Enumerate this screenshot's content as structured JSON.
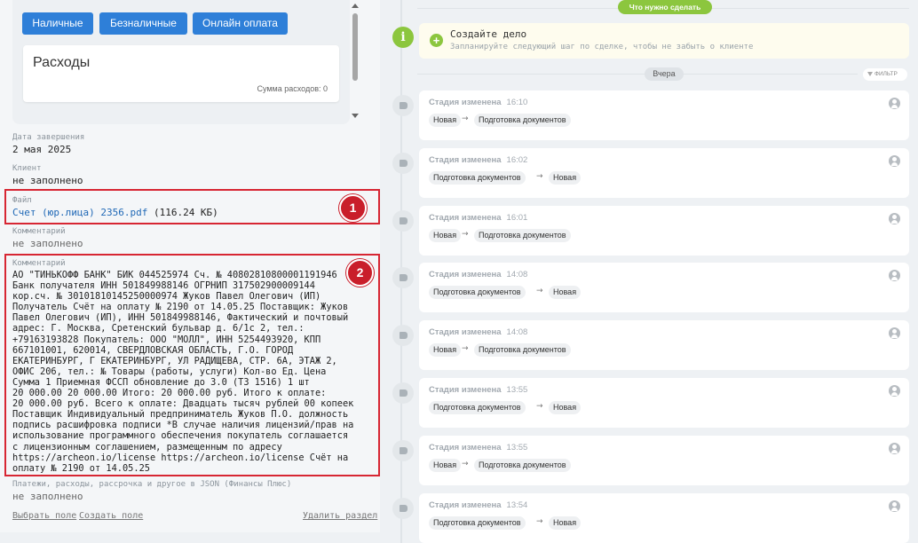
{
  "payment_buttons": [
    "Наличные",
    "Безналичные",
    "Онлайн оплата"
  ],
  "expenses": {
    "title": "Расходы",
    "sum_label": "Сумма расходов: 0"
  },
  "fields": {
    "completion_date": {
      "label": "Дата завершения",
      "value": "2 мая 2025"
    },
    "client": {
      "label": "Клиент",
      "value": "не заполнено"
    },
    "file": {
      "label": "Файл",
      "name": "Счет (юр.лица) 2356.pdf",
      "size": "(116.24 КБ)"
    },
    "comment1": {
      "label": "Комментарий",
      "value": "не заполнено"
    },
    "comment2": {
      "label": "Комментарий",
      "lines": [
        "АО \"ТИНЬКОФФ БАНК\" БИК 044525974 Сч. № 40802810800001191946",
        "Банк получателя ИНН 501849988146 ОГРНИП 317502900009144",
        "кор.сч. № 30101810145250000974 Жуков Павел Олегович (ИП)",
        "Получатель Счёт на оплату № 2190 от 14.05.25 Поставщик: Жуков",
        "Павел Олегович (ИП), ИНН 501849988146, Фактический и почтовый",
        "адрес: Г. Москва, Сретенский бульвар д. 6/1с 2, тел.:",
        "+79163193828 Покупатель: ООО \"МОЛЛ\", ИНН 5254493920, КПП",
        "667101001, 620014, СВЕРДЛОВСКАЯ ОБЛАСТЬ, Г.О. ГОРОД",
        "ЕКАТЕРИНБУРГ, Г ЕКАТЕРИНБУРГ, УЛ РАДИЩЕВА, СТР. 6А, ЭТАЖ 2,",
        "ОФИС 206, тел.: № Товары (работы, услуги) Кол-во Ед. Цена",
        "Сумма 1 Приемная ФССП обновление до 3.0 (Т3 1516) 1 шт",
        "20 000.00 20 000.00 Итого: 20 000.00 руб. Итого к оплате:",
        "20 000.00 руб. Всего к оплате: Двадцать тысяч рублей 00 копеек",
        "Поставщик Индивидуальный предприниматель Жуков П.О. должность",
        "подпись расшифровка подписи *В случае наличия лицензий/прав на",
        "использование программного обеспечения покупатель соглашается",
        "с лицензионным соглашением, размещенным по адресу",
        "https://archeon.io/license https://archeon.io/license Счёт на",
        "оплату № 2190 от 14.05.25"
      ]
    },
    "payments_json": {
      "label": "Платежи, расходы, рассрочка и другое в JSON (Финансы Плюс)",
      "value": "не заполнено"
    }
  },
  "markers": [
    "1",
    "2"
  ],
  "bottom_links": {
    "choose": "Выбрать поле",
    "create": "Создать поле",
    "delete": "Удалить раздел"
  },
  "timeline": {
    "todo_pill": "Что нужно сделать",
    "todo_title": "Создайте дело",
    "todo_subtitle": "Запланируйте следующий шаг по сделке, чтобы не забыть о клиенте",
    "day_label": "Вчера",
    "filter_label": "ФИЛЬТР",
    "events": [
      {
        "title": "Стадия изменена",
        "time": "16:10",
        "from": "Новая",
        "to": "Подготовка документов"
      },
      {
        "title": "Стадия изменена",
        "time": "16:02",
        "from": "Подготовка документов",
        "to": "Новая"
      },
      {
        "title": "Стадия изменена",
        "time": "16:01",
        "from": "Новая",
        "to": "Подготовка документов"
      },
      {
        "title": "Стадия изменена",
        "time": "14:08",
        "from": "Подготовка документов",
        "to": "Новая"
      },
      {
        "title": "Стадия изменена",
        "time": "14:08",
        "from": "Новая",
        "to": "Подготовка документов"
      },
      {
        "title": "Стадия изменена",
        "time": "13:55",
        "from": "Подготовка документов",
        "to": "Новая"
      },
      {
        "title": "Стадия изменена",
        "time": "13:55",
        "from": "Новая",
        "to": "Подготовка документов"
      },
      {
        "title": "Стадия изменена",
        "time": "13:54",
        "from": "Подготовка документов",
        "to": "Новая"
      }
    ]
  },
  "colors": {
    "primary_button": "#2e7fd8",
    "accent_green": "#8cc63e",
    "highlight_red": "#d72633",
    "link": "#1f68b6"
  }
}
